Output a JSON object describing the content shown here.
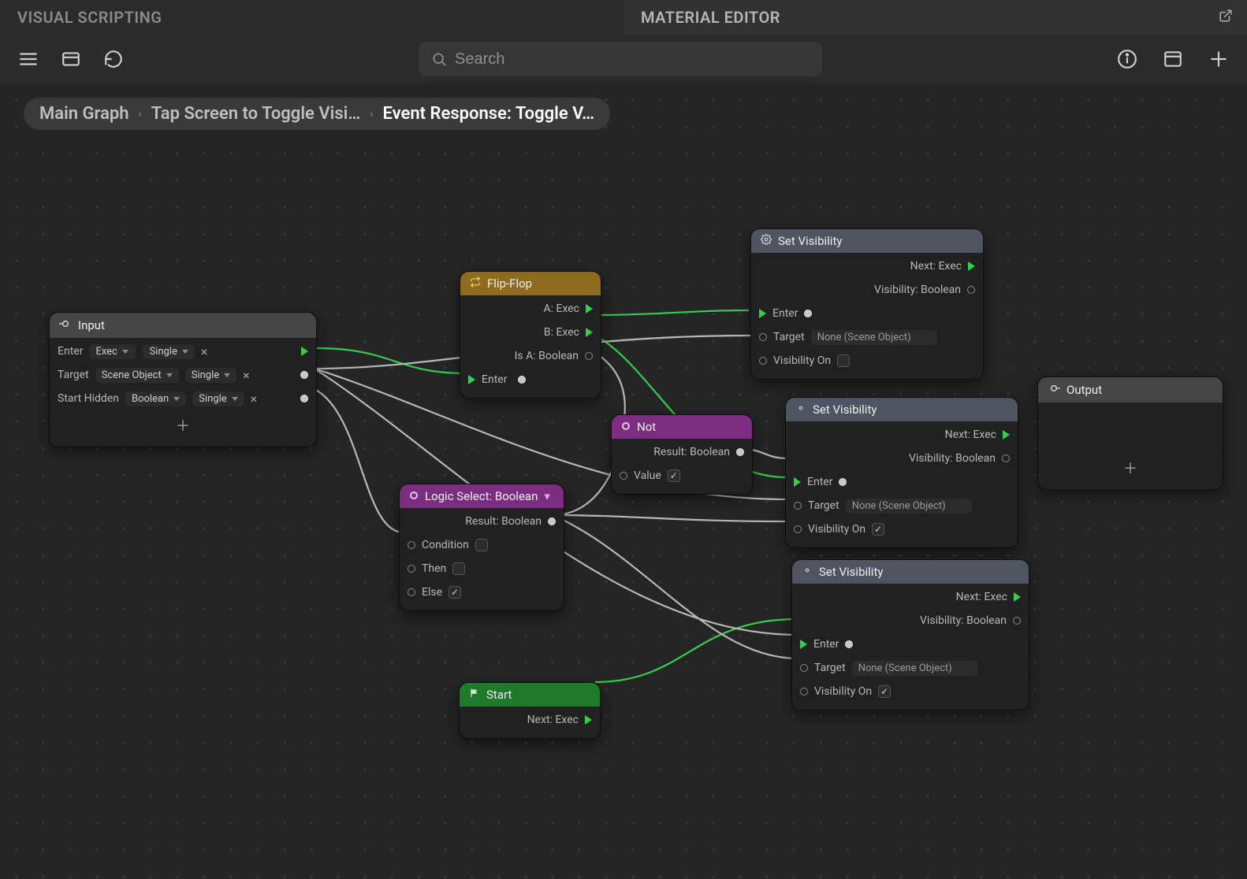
{
  "tabs": {
    "visual_scripting": "VISUAL SCRIPTING",
    "material_editor": "MATERIAL EDITOR"
  },
  "toolbar": {
    "search_placeholder": "Search"
  },
  "breadcrumb": {
    "seg0": "Main Graph",
    "seg1": "Tap Screen to Toggle Visi…",
    "seg2": "Event Response: Toggle V…"
  },
  "nodes": {
    "input": {
      "title": "Input",
      "rows": {
        "enter": "Enter",
        "enter_type": "Exec",
        "enter_mode": "Single",
        "target": "Target",
        "target_type": "Scene Object",
        "target_mode": "Single",
        "hidden": "Start Hidden",
        "hidden_type": "Boolean",
        "hidden_mode": "Single"
      }
    },
    "flipflop": {
      "title": "Flip-Flop",
      "a": "A: Exec",
      "b": "B: Exec",
      "isa": "Is A: Boolean",
      "enter": "Enter"
    },
    "logic": {
      "title": "Logic Select: Boolean",
      "result": "Result: Boolean",
      "condition": "Condition",
      "then": "Then",
      "else": "Else"
    },
    "not": {
      "title": "Not",
      "result": "Result: Boolean",
      "value": "Value"
    },
    "start": {
      "title": "Start",
      "next": "Next: Exec"
    },
    "setvis": {
      "title": "Set Visibility",
      "next": "Next: Exec",
      "vis": "Visibility: Boolean",
      "enter": "Enter",
      "target": "Target",
      "target_val": "None (Scene Object)",
      "vison": "Visibility On"
    },
    "output": {
      "title": "Output"
    }
  }
}
